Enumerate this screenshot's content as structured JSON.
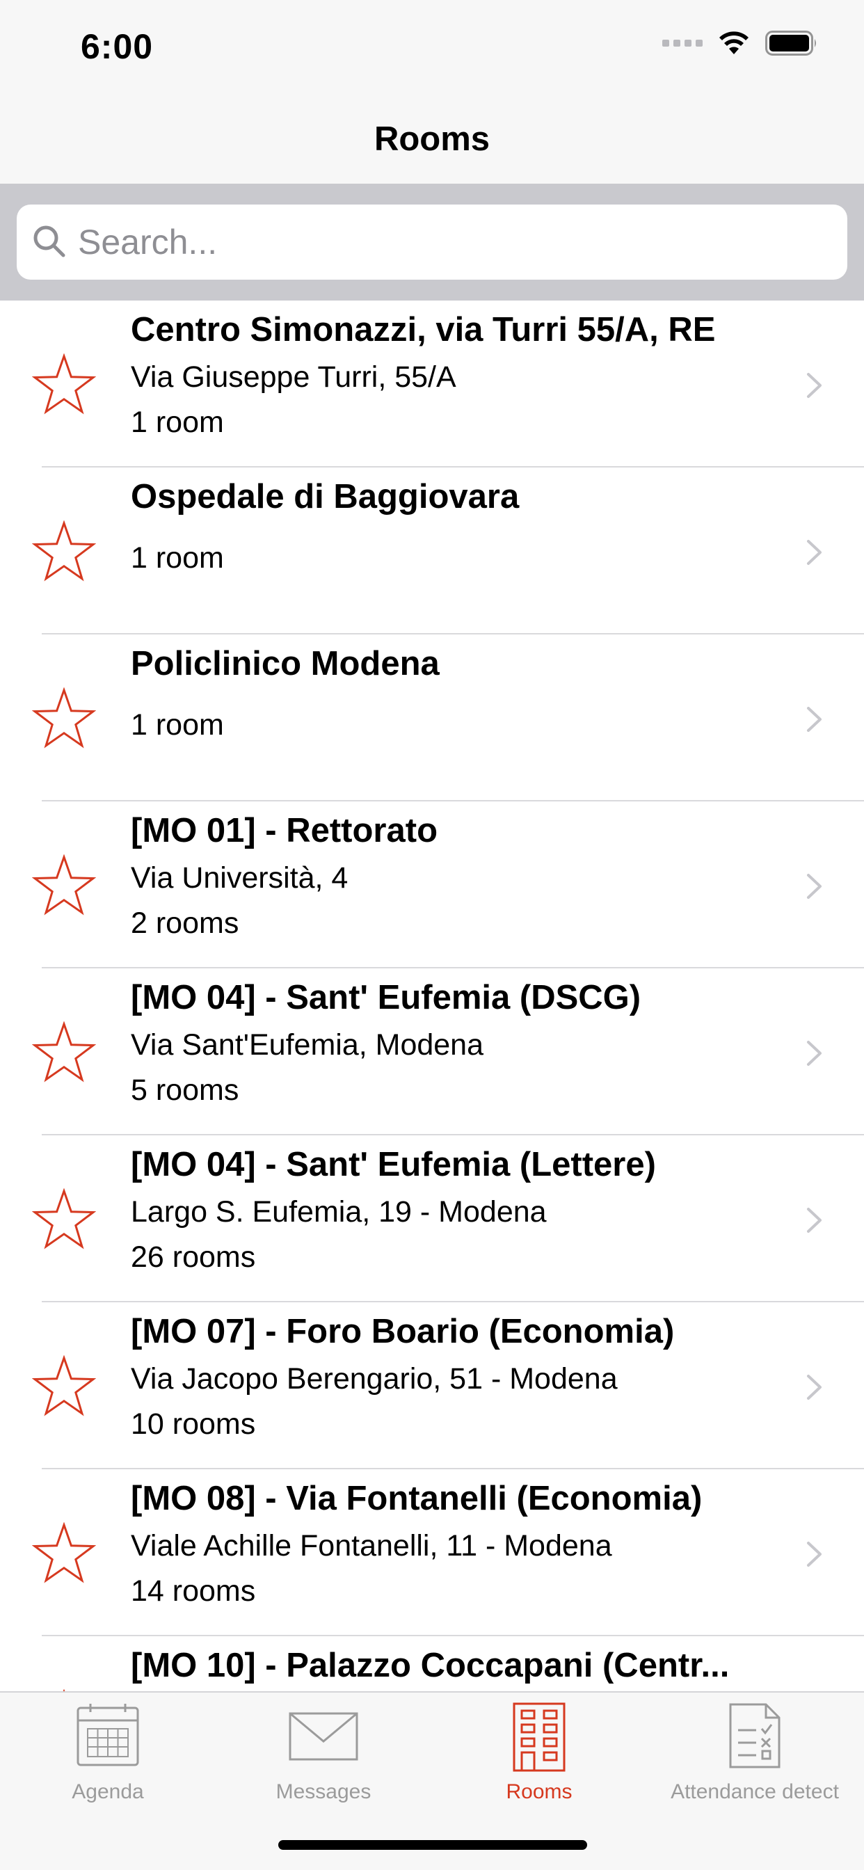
{
  "status_bar": {
    "time": "6:00"
  },
  "nav": {
    "title": "Rooms"
  },
  "search": {
    "placeholder": "Search..."
  },
  "colors": {
    "accent": "#d6391f",
    "chevron": "#c7c7cc",
    "tab_inactive": "#9b9b9b"
  },
  "rooms": [
    {
      "title": "Centro Simonazzi, via Turri 55/A, RE",
      "address": "Via Giuseppe Turri, 55/A",
      "count": "1 room"
    },
    {
      "title": "Ospedale di Baggiovara",
      "address": "",
      "count": "1 room"
    },
    {
      "title": "Policlinico Modena",
      "address": "",
      "count": "1 room"
    },
    {
      "title": "[MO 01]  - Rettorato",
      "address": "Via Università, 4",
      "count": "2 rooms"
    },
    {
      "title": "[MO 04] - Sant' Eufemia (DSCG)",
      "address": "Via Sant'Eufemia, Modena",
      "count": "5 rooms"
    },
    {
      "title": "[MO 04] - Sant' Eufemia (Lettere)",
      "address": "Largo S. Eufemia, 19 - Modena",
      "count": "26 rooms"
    },
    {
      "title": "[MO 07]  - Foro Boario (Economia)",
      "address": "Via Jacopo Berengario, 51 - Modena",
      "count": "10 rooms"
    },
    {
      "title": "[MO 08] - Via Fontanelli (Economia)",
      "address": "Viale Achille Fontanelli, 11 - Modena",
      "count": "14 rooms"
    },
    {
      "title": "[MO 10] - Palazzo Coccapani (Centr...",
      "address": "",
      "count": ""
    }
  ],
  "tabs": [
    {
      "label": "Agenda",
      "icon": "calendar-icon",
      "active": false
    },
    {
      "label": "Messages",
      "icon": "envelope-icon",
      "active": false
    },
    {
      "label": "Rooms",
      "icon": "building-icon",
      "active": true
    },
    {
      "label": "Attendance detect",
      "icon": "checklist-document-icon",
      "active": false
    }
  ]
}
